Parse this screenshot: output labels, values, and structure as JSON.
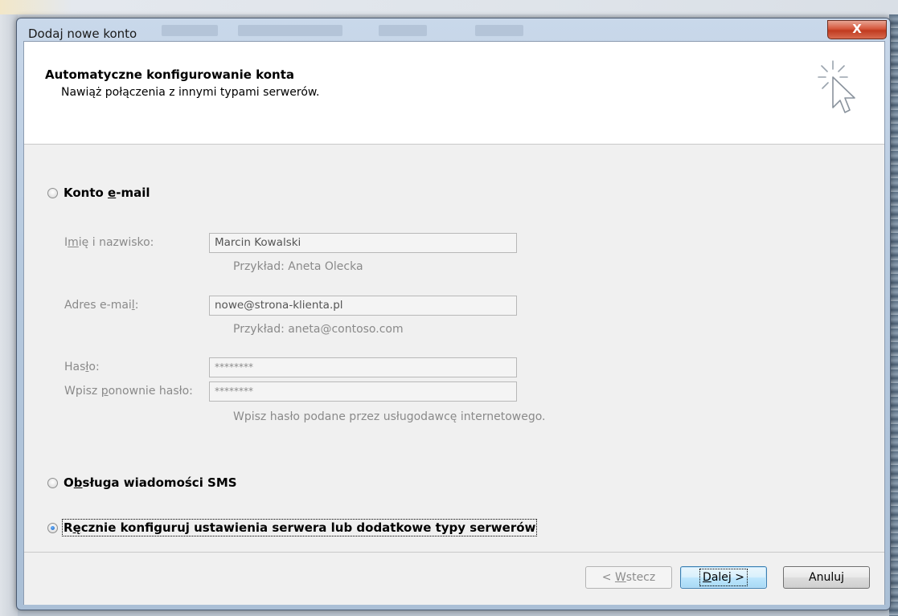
{
  "window": {
    "title": "Dodaj nowe konto",
    "close_glyph": "X"
  },
  "header": {
    "title": "Automatyczne konfigurowanie konta",
    "subtitle": "Nawiąż połączenia z innymi typami serwerów.",
    "icon": "cursor-sparkle-icon"
  },
  "options": {
    "email": {
      "pre": "Konto ",
      "u": "e",
      "post": "-mail",
      "selected": false
    },
    "sms": {
      "pre": "O",
      "u": "b",
      "post": "sługa wiadomości SMS",
      "selected": false
    },
    "manual": {
      "pre": "R",
      "u": "ę",
      "post": "cznie konfiguruj ustawienia serwera lub dodatkowe typy serwerów",
      "selected": true
    }
  },
  "form": {
    "name": {
      "label_pre": "I",
      "label_u": "m",
      "label_post": "ię i nazwisko:",
      "value": "Marcin Kowalski",
      "hint": "Przykład: Aneta Olecka"
    },
    "email": {
      "label_pre": "Adres e-mai",
      "label_u": "l",
      "label_post": ":",
      "value": "nowe@strona-klienta.pl",
      "hint": "Przykład: aneta@contoso.com"
    },
    "password": {
      "label_pre": "Has",
      "label_u": "ł",
      "label_post": "o:",
      "value": "********"
    },
    "password_repeat": {
      "label_pre": "Wpisz ",
      "label_u": "p",
      "label_post": "onownie hasło:",
      "value": "********",
      "hint": "Wpisz hasło podane przez usługodawcę internetowego."
    }
  },
  "buttons": {
    "back": {
      "pre": "< ",
      "u": "W",
      "post": "stecz"
    },
    "next": {
      "pre": "",
      "u": "D",
      "post": "alej >"
    },
    "cancel": {
      "label": "Anuluj"
    }
  }
}
